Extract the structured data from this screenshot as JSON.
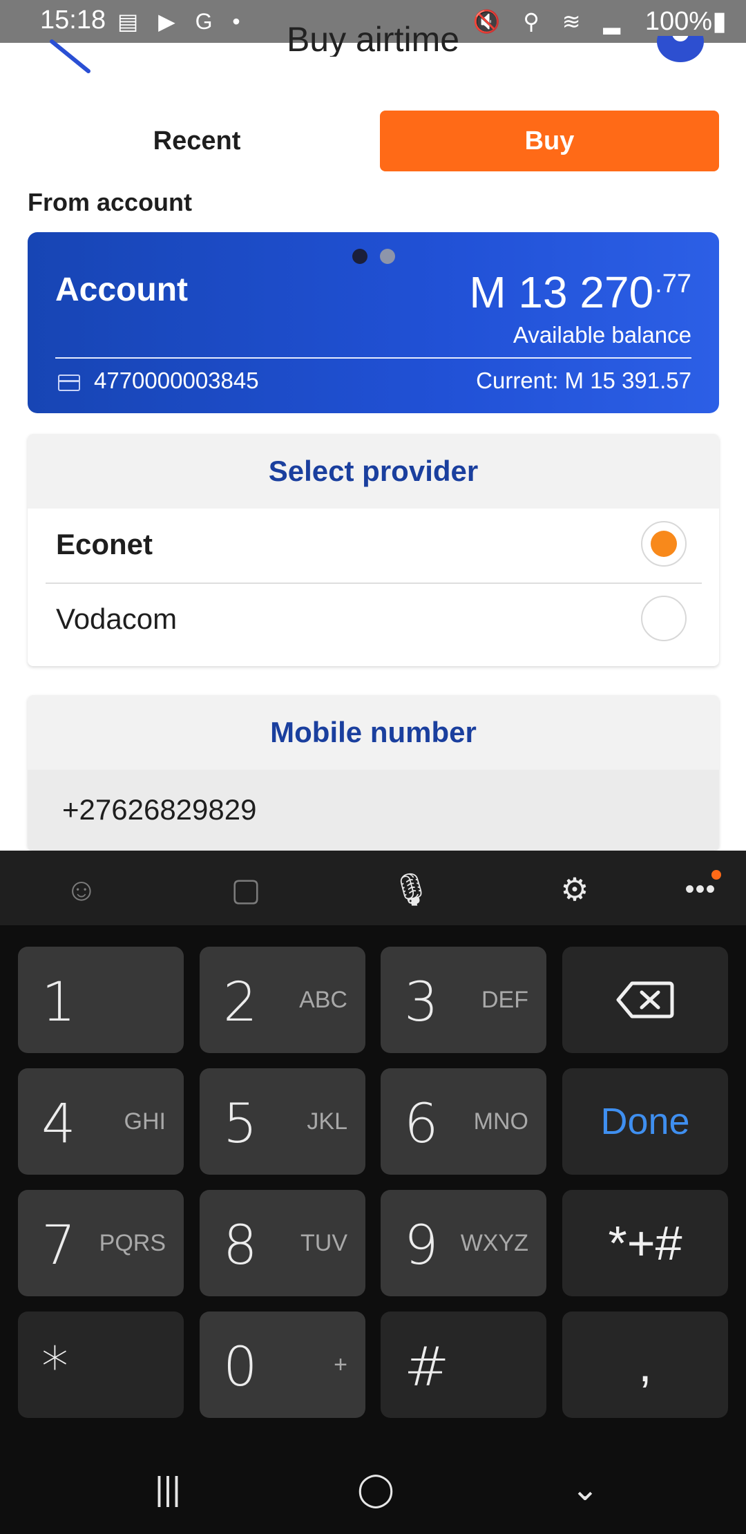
{
  "status_bar": {
    "time": "15:18",
    "left_icons": "▤ ▶ G •",
    "right_icons": "🔇 ⚲ ≋ ▂",
    "battery": "100%▮"
  },
  "header": {
    "title": "Buy airtime"
  },
  "tabs": {
    "recent": "Recent",
    "buy": "Buy"
  },
  "from_account_label": "From account",
  "account": {
    "name": "Account",
    "amount_main": "M 13 270",
    "amount_cents": ".77",
    "available_label": "Available balance",
    "number": "4770000003845",
    "current": "Current: M 15 391.57"
  },
  "provider": {
    "heading": "Select provider",
    "options": [
      {
        "label": "Econet",
        "selected": true
      },
      {
        "label": "Vodacom",
        "selected": false
      }
    ]
  },
  "mobile": {
    "heading": "Mobile number",
    "value": "+27626829829"
  },
  "keyboard": {
    "toolbar": {
      "emoji": "☺",
      "sticker": "▢",
      "mic": "🎙",
      "settings": "⚙",
      "more": "•••"
    },
    "keys": {
      "k1": {
        "main": "1",
        "sub": ""
      },
      "k2": {
        "main": "2",
        "sub": "ABC"
      },
      "k3": {
        "main": "3",
        "sub": "DEF"
      },
      "k4": {
        "main": "4",
        "sub": "GHI"
      },
      "k5": {
        "main": "5",
        "sub": "JKL"
      },
      "k6": {
        "main": "6",
        "sub": "MNO"
      },
      "k7": {
        "main": "7",
        "sub": "PQRS"
      },
      "k8": {
        "main": "8",
        "sub": "TUV"
      },
      "k9": {
        "main": "9",
        "sub": "WXYZ"
      },
      "k0": {
        "main": "0",
        "sub": "+"
      },
      "star": "*",
      "hash": "#",
      "comma": ",",
      "done": "Done",
      "symbols": "*+#",
      "backspace": "⌫"
    }
  },
  "nav": {
    "recent": "|||",
    "home": "◯",
    "back": "⌄"
  },
  "colors": {
    "accent": "#ff6a17",
    "brand_blue": "#1a3f9e",
    "card_blue": "#1f4fd2",
    "done_blue": "#3f8ff0"
  }
}
